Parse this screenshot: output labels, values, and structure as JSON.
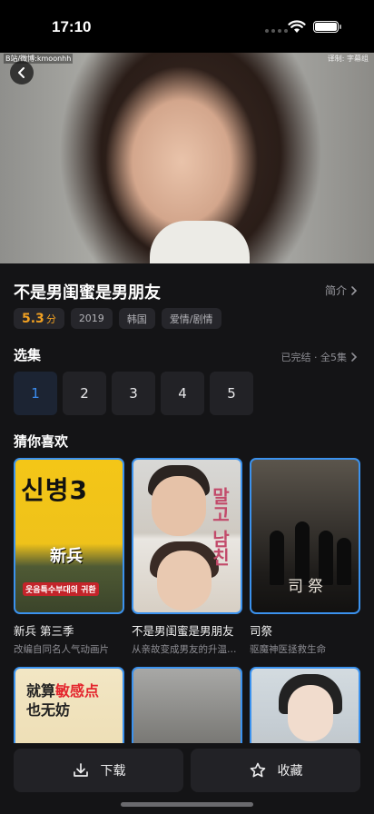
{
  "status_bar": {
    "time": "17:10"
  },
  "player": {
    "watermark_left": "B站/微博:kmoonhh",
    "watermark_right": "译制: 字幕组"
  },
  "show": {
    "title": "不是男闺蜜是男朋友",
    "intro_label": "简介",
    "score": "5.3",
    "score_unit": "分",
    "year": "2019",
    "region": "韩国",
    "genre": "爱情/剧情"
  },
  "episodes": {
    "section_title": "选集",
    "status": "已完结 · 全5集",
    "items": [
      "1",
      "2",
      "3",
      "4",
      "5"
    ],
    "selected": "1"
  },
  "recommend": {
    "section_title": "猜你喜欢",
    "items": [
      {
        "name": "新兵 第三季",
        "desc": "改编自同名人气动画片",
        "poster_big": "신병3",
        "poster_mid": "新兵",
        "poster_foot": "웃음특수부대의 귀환"
      },
      {
        "name": "不是男闺蜜是男朋友",
        "desc": "从亲故变成男友的升温之路",
        "poster_kr": "말고 남친"
      },
      {
        "name": "司祭",
        "desc": "驱魔神医拯救生命",
        "poster_text": "司祭"
      },
      {
        "name": "",
        "desc": "",
        "poster_text": "就算敏感点也无妨",
        "poster_highlight": "敏感点"
      },
      {
        "name": "",
        "desc": ""
      },
      {
        "name": "",
        "desc": ""
      }
    ]
  },
  "actions": {
    "download_label": "下载",
    "favorite_label": "收藏"
  },
  "colors": {
    "accent": "#3b8cf0",
    "score": "#f0a022",
    "background": "#141416"
  }
}
